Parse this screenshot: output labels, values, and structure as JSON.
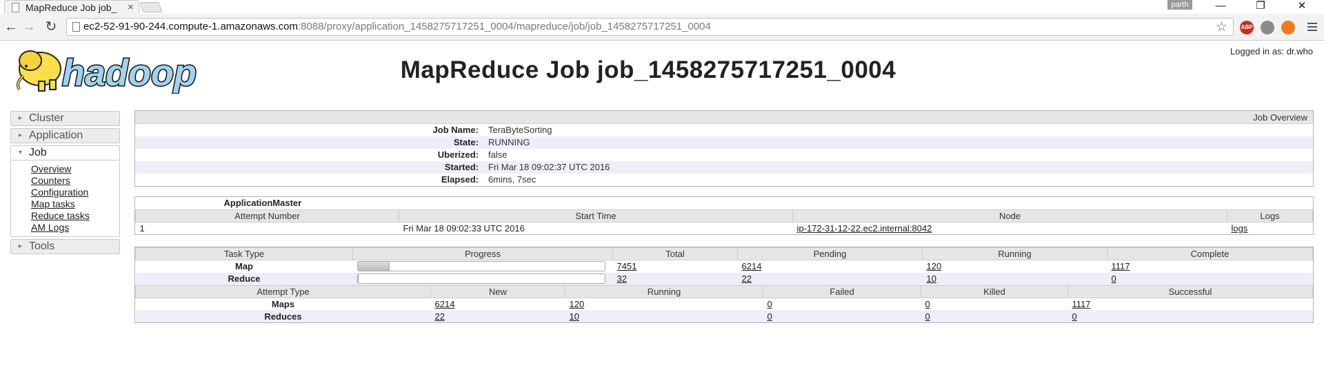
{
  "browser": {
    "tab_title": "MapReduce Job job_",
    "tab_close": "×",
    "user_badge": "parth",
    "url_host": "ec2-52-91-90-244.compute-1.amazonaws.com",
    "url_rest": ":8088/proxy/application_1458275717251_0004/mapreduce/job/job_1458275717251_0004",
    "ext_abp": "ABP",
    "win_min": "—",
    "win_max": "❐",
    "win_close": "✕"
  },
  "header": {
    "logo_text": "hadoop",
    "title": "MapReduce Job job_1458275717251_0004",
    "logged_in": "Logged in as: dr.who"
  },
  "sidebar": {
    "sections": [
      {
        "label": "Cluster"
      },
      {
        "label": "Application"
      },
      {
        "label": "Job"
      },
      {
        "label": "Tools"
      }
    ],
    "job_links": [
      "Overview",
      "Counters",
      "Configuration",
      "Map tasks",
      "Reduce tasks",
      "AM Logs"
    ]
  },
  "overview": {
    "heading": "Job Overview",
    "rows": [
      {
        "key": "Job Name:",
        "value": "TeraByteSorting"
      },
      {
        "key": "State:",
        "value": "RUNNING"
      },
      {
        "key": "Uberized:",
        "value": "false"
      },
      {
        "key": "Started:",
        "value": "Fri Mar 18 09:02:37 UTC 2016"
      },
      {
        "key": "Elapsed:",
        "value": "6mins, 7sec"
      }
    ]
  },
  "am": {
    "heading": "ApplicationMaster",
    "columns": [
      "Attempt Number",
      "Start Time",
      "Node",
      "Logs"
    ],
    "row": {
      "attempt": "1",
      "start": "Fri Mar 18 09:02:33 UTC 2016",
      "node": "ip-172-31-12-22.ec2.internal:8042",
      "logs": "logs"
    }
  },
  "tasks": {
    "columns": [
      "Task Type",
      "Progress",
      "Total",
      "Pending",
      "Running",
      "Complete"
    ],
    "rows": [
      {
        "type": "Map",
        "progress": 0.13,
        "total": "7451",
        "pending": "6214",
        "running": "120",
        "complete": "1117"
      },
      {
        "type": "Reduce",
        "progress": 0.0,
        "total": "32",
        "pending": "22",
        "running": "10",
        "complete": "0"
      }
    ]
  },
  "attempts": {
    "columns": [
      "Attempt Type",
      "New",
      "Running",
      "Failed",
      "Killed",
      "Successful"
    ],
    "rows": [
      {
        "type": "Maps",
        "new": "6214",
        "running": "120",
        "failed": "0",
        "killed": "0",
        "successful": "1117"
      },
      {
        "type": "Reduces",
        "new": "22",
        "running": "10",
        "failed": "0",
        "killed": "0",
        "successful": "0"
      }
    ]
  },
  "colors": {
    "accent_row": "#eeeef8",
    "header_row": "#e6e6e6",
    "logo_yellow": "#f9e04b",
    "logo_blue": "#9fd3f0"
  }
}
